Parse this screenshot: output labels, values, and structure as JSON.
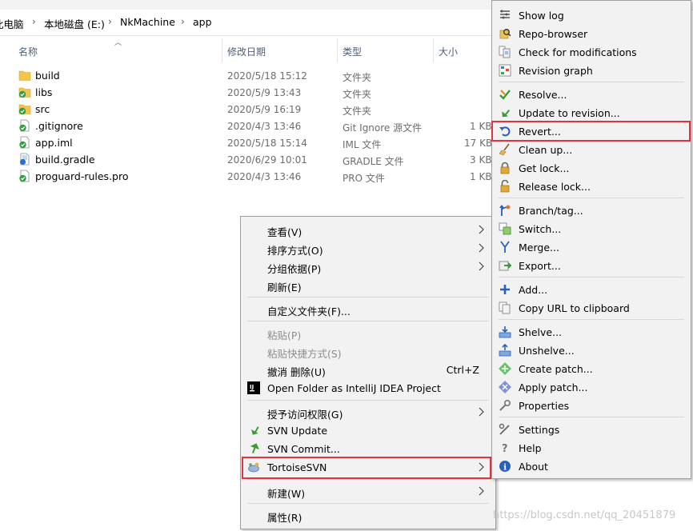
{
  "breadcrumb": {
    "items": [
      "此电脑",
      "本地磁盘 (E:)",
      "NkMachine",
      "app"
    ]
  },
  "columns": {
    "name": "名称",
    "date": "修改日期",
    "type": "类型",
    "size": "大小"
  },
  "files": [
    {
      "name": "build",
      "date": "2020/5/18 15:12",
      "type": "文件夹",
      "size": "",
      "icon": "folder-icon"
    },
    {
      "name": "libs",
      "date": "2020/5/9 13:43",
      "type": "文件夹",
      "size": "",
      "icon": "folder-svn-ok-icon"
    },
    {
      "name": "src",
      "date": "2020/5/9 16:19",
      "type": "文件夹",
      "size": "",
      "icon": "folder-svn-ok-icon"
    },
    {
      "name": ".gitignore",
      "date": "2020/4/3 13:46",
      "type": "Git Ignore 源文件",
      "size": "1 KB",
      "icon": "file-svn-ok-icon"
    },
    {
      "name": "app.iml",
      "date": "2020/5/18 15:14",
      "type": "IML 文件",
      "size": "17 KB",
      "icon": "file-svn-ok-icon"
    },
    {
      "name": "build.gradle",
      "date": "2020/6/29 10:01",
      "type": "GRADLE 文件",
      "size": "3 KB",
      "icon": "file-svn-modified-icon"
    },
    {
      "name": "proguard-rules.pro",
      "date": "2020/4/3 13:46",
      "type": "PRO 文件",
      "size": "1 KB",
      "icon": "file-svn-ok-icon"
    }
  ],
  "context_menu": {
    "items": [
      {
        "label": "查看(V)",
        "arrow": true
      },
      {
        "label": "排序方式(O)",
        "arrow": true
      },
      {
        "label": "分组依据(P)",
        "arrow": true
      },
      {
        "label": "刷新(E)"
      },
      {
        "label": "自定义文件夹(F)..."
      },
      {
        "label": "粘贴(P)",
        "disabled": true
      },
      {
        "label": "粘贴快捷方式(S)",
        "disabled": true
      },
      {
        "label": "撤消 删除(U)",
        "shortcut": "Ctrl+Z"
      },
      {
        "label": "Open Folder as IntelliJ IDEA Project",
        "icon": "intellij-icon"
      },
      {
        "label": "授予访问权限(G)",
        "arrow": true
      },
      {
        "label": "SVN Update",
        "icon": "svn-update-icon"
      },
      {
        "label": "SVN Commit...",
        "icon": "svn-commit-icon"
      },
      {
        "label": "TortoiseSVN",
        "icon": "tortoisesvn-icon",
        "arrow": true,
        "highlighted": true
      },
      {
        "label": "新建(W)",
        "arrow": true
      },
      {
        "label": "属性(R)"
      }
    ]
  },
  "svn_submenu": {
    "items": [
      {
        "label": "Show log",
        "icon": "show-log-icon"
      },
      {
        "label": "Repo-browser",
        "icon": "repo-browser-icon"
      },
      {
        "label": "Check for modifications",
        "icon": "check-modifications-icon"
      },
      {
        "label": "Revision graph",
        "icon": "revision-graph-icon"
      },
      {
        "label": "Resolve...",
        "icon": "resolve-icon"
      },
      {
        "label": "Update to revision...",
        "icon": "update-revision-icon"
      },
      {
        "label": "Revert...",
        "icon": "revert-icon",
        "highlighted": true
      },
      {
        "label": "Clean up...",
        "icon": "cleanup-icon"
      },
      {
        "label": "Get lock...",
        "icon": "get-lock-icon"
      },
      {
        "label": "Release lock...",
        "icon": "release-lock-icon"
      },
      {
        "label": "Branch/tag...",
        "icon": "branch-tag-icon"
      },
      {
        "label": "Switch...",
        "icon": "switch-icon"
      },
      {
        "label": "Merge...",
        "icon": "merge-icon"
      },
      {
        "label": "Export...",
        "icon": "export-icon"
      },
      {
        "label": "Add...",
        "icon": "add-icon"
      },
      {
        "label": "Copy URL to clipboard",
        "icon": "copy-url-icon"
      },
      {
        "label": "Shelve...",
        "icon": "shelve-icon"
      },
      {
        "label": "Unshelve...",
        "icon": "unshelve-icon"
      },
      {
        "label": "Create patch...",
        "icon": "create-patch-icon"
      },
      {
        "label": "Apply patch...",
        "icon": "apply-patch-icon"
      },
      {
        "label": "Properties",
        "icon": "properties-icon"
      },
      {
        "label": "Settings",
        "icon": "settings-icon"
      },
      {
        "label": "Help",
        "icon": "help-icon"
      },
      {
        "label": "About",
        "icon": "about-icon"
      }
    ]
  },
  "watermark": "https://blog.csdn.net/qq_20451879",
  "colors": {
    "highlight_border": "#e0343f",
    "menu_bg": "#f2f2f2",
    "folder": "#f3c44f",
    "svn_ok": "#2ea043",
    "svn_modified": "#d9342b"
  }
}
